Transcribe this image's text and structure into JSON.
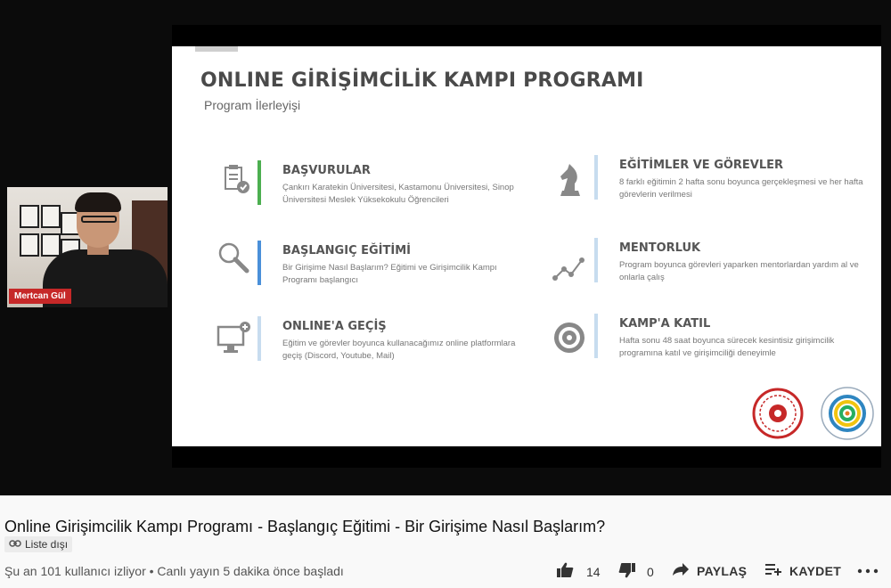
{
  "slide": {
    "title": "ONLINE GİRİŞİMCİLİK KAMPI PROGRAMI",
    "subtitle": "Program İlerleyişi",
    "items": [
      {
        "title": "BAŞVURULAR",
        "desc": "Çankırı Karatekin Üniversitesi, Kastamonu Üniversitesi, Sinop Üniversitesi Meslek Yüksekokulu Öğrencileri",
        "color": "#4caf50",
        "icon": "clipboard-check-icon"
      },
      {
        "title": "BAŞLANGIÇ EĞİTİMİ",
        "desc": "Bir Girişime Nasıl Başlarım? Eğitimi ve Girişimcilik Kampı Programı başlangıcı",
        "color": "#4a90d9",
        "icon": "magnifier-icon"
      },
      {
        "title": "ONLINE'A GEÇİŞ",
        "desc": "Eğitim ve görevler boyunca kullanacağımız online platformlara geçiş (Discord, Youtube, Mail)",
        "color": "#c7dcef",
        "icon": "monitor-add-icon"
      },
      {
        "title": "EĞİTİMLER VE GÖREVLER",
        "desc": "8 farklı eğitimin 2 hafta sonu boyunca gerçekleşmesi ve her hafta görevlerin verilmesi",
        "color": "#c7dcef",
        "icon": "chess-knight-icon"
      },
      {
        "title": "MENTORLUK",
        "desc": "Program boyunca görevleri yaparken mentorlardan yardım al ve onlarla çalış",
        "color": "#c7dcef",
        "icon": "line-graph-icon"
      },
      {
        "title": "KAMP'A KATIL",
        "desc": "Hafta sonu 48 saat boyunca sürecek kesintisiz girişimcilik programına katıl ve girişimciliği deneyimle",
        "color": "#c7dcef",
        "icon": "target-icon"
      }
    ]
  },
  "presenter": {
    "name": "Mertcan Gül"
  },
  "video": {
    "title": "Online Girişimcilik Kampı Programı - Başlangıç Eğitimi - Bir Girişime Nasıl Başlarım?",
    "visibility": "Liste dışı",
    "meta": "Şu an 101 kullanıcı izliyor • Canlı yayın 5 dakika önce başladı"
  },
  "actions": {
    "likes": "14",
    "dislikes": "0",
    "share": "PAYLAŞ",
    "save": "KAYDET"
  }
}
